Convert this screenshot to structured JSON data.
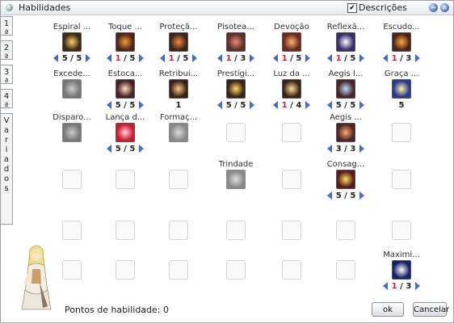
{
  "window": {
    "title": "Habilidades",
    "descriptions_label": "Descrições",
    "descriptions_checked": true
  },
  "tabs": [
    "1ª",
    "2ª",
    "3ª",
    "4ª",
    "Variados"
  ],
  "selected_tab": "3ª",
  "skills": [
    {
      "name": "Espiral ...",
      "col": 0,
      "row": 0,
      "level": "5",
      "max": "5",
      "arrows": true,
      "icon": "spiral-skill-icon",
      "color": "#3a2a18",
      "accent": "#ffcc66"
    },
    {
      "name": "Toque ...",
      "col": 1,
      "row": 0,
      "level": "1",
      "max": "5",
      "arrows": true,
      "icon": "touch-skill-icon",
      "color": "#4a2418",
      "accent": "#ff9933"
    },
    {
      "name": "Proteçã...",
      "col": 2,
      "row": 0,
      "level": "1",
      "max": "5",
      "arrows": true,
      "icon": "protection-skill-icon",
      "color": "#3a2418",
      "accent": "#ff8844"
    },
    {
      "name": "Pisotea...",
      "col": 3,
      "row": 0,
      "level": "1",
      "max": "3",
      "arrows": true,
      "icon": "trample-skill-icon",
      "color": "#5a3028",
      "accent": "#ee8877"
    },
    {
      "name": "Devoção",
      "col": 4,
      "row": 0,
      "level": "1",
      "max": "5",
      "arrows": true,
      "icon": "devotion-skill-icon",
      "color": "#6a2a20",
      "accent": "#ffb070"
    },
    {
      "name": "Reflexã...",
      "col": 5,
      "row": 0,
      "level": "1",
      "max": "5",
      "arrows": true,
      "icon": "reflect-skill-icon",
      "color": "#3a2a6a",
      "accent": "#ffffff"
    },
    {
      "name": "Escudo...",
      "col": 6,
      "row": 0,
      "level": "1",
      "max": "3",
      "arrows": true,
      "icon": "shield-skill-icon",
      "color": "#4a2418",
      "accent": "#ffaa44"
    },
    {
      "name": "Excede...",
      "col": 0,
      "row": 1,
      "level": "",
      "max": "",
      "arrows": false,
      "icon": "exceed-skill-icon",
      "color": "#777777",
      "accent": "#cccccc",
      "disabled": true
    },
    {
      "name": "Estoca...",
      "col": 1,
      "row": 1,
      "level": "5",
      "max": "5",
      "arrows": true,
      "icon": "thrust-skill-icon",
      "color": "#4a2028",
      "accent": "#ffe0c0"
    },
    {
      "name": "Retribui...",
      "col": 2,
      "row": 1,
      "level": "1",
      "max": "",
      "arrows": false,
      "icon": "retribution-skill-icon",
      "color": "#3a2018",
      "accent": "#ffcc88"
    },
    {
      "name": "Prestígi...",
      "col": 3,
      "row": 1,
      "level": "5",
      "max": "5",
      "arrows": true,
      "icon": "prestige-skill-icon",
      "color": "#3a2018",
      "accent": "#ffdd66"
    },
    {
      "name": "Luz da ...",
      "col": 4,
      "row": 1,
      "level": "1",
      "max": "4",
      "arrows": true,
      "icon": "light-skill-icon",
      "color": "#3a2418",
      "accent": "#ffdd99"
    },
    {
      "name": "Aegis I...",
      "col": 5,
      "row": 1,
      "level": "5",
      "max": "5",
      "arrows": true,
      "icon": "aegis-skill-icon",
      "color": "#4a2428",
      "accent": "#bbddff"
    },
    {
      "name": "Graça ...",
      "col": 6,
      "row": 1,
      "level": "5",
      "max": "",
      "arrows": false,
      "icon": "grace-skill-icon",
      "color": "#2a3a8a",
      "accent": "#ffeeaa"
    },
    {
      "name": "Disparo...",
      "col": 0,
      "row": 2,
      "level": "",
      "max": "",
      "arrows": false,
      "icon": "shot-skill-icon",
      "color": "#777777",
      "accent": "#cccccc",
      "disabled": true
    },
    {
      "name": "Lança d...",
      "col": 1,
      "row": 2,
      "level": "5",
      "max": "5",
      "arrows": true,
      "icon": "lance-skill-icon",
      "color": "#cc1a2a",
      "accent": "#ffccdd"
    },
    {
      "name": "Formaç...",
      "col": 2,
      "row": 2,
      "level": "",
      "max": "",
      "arrows": false,
      "icon": "formation-skill-icon",
      "color": "#888888",
      "accent": "#dddddd",
      "disabled": true
    },
    {
      "name": "Aegis ...",
      "col": 5,
      "row": 2,
      "level": "3",
      "max": "3",
      "arrows": true,
      "icon": "aegis-skill-icon",
      "color": "#4a2428",
      "accent": "#ffaa66"
    },
    {
      "name": "Trindade",
      "col": 3,
      "row": 3,
      "level": "",
      "max": "",
      "arrows": false,
      "icon": "trinity-skill-icon",
      "color": "#8a8a8a",
      "accent": "#e0e0e0",
      "disabled": true
    },
    {
      "name": "Consag...",
      "col": 5,
      "row": 3,
      "level": "5",
      "max": "5",
      "arrows": true,
      "icon": "consecration-skill-icon",
      "color": "#5a1a18",
      "accent": "#ffdd66"
    },
    {
      "name": "Maximi...",
      "col": 6,
      "row": 5,
      "level": "1",
      "max": "3",
      "arrows": true,
      "icon": "maximize-skill-icon",
      "color": "#18206a",
      "accent": "#ffffff"
    }
  ],
  "footer": {
    "points_label": "Pontos de habilidade: 0",
    "ok_label": "ok",
    "cancel_label": "Cancelar"
  }
}
